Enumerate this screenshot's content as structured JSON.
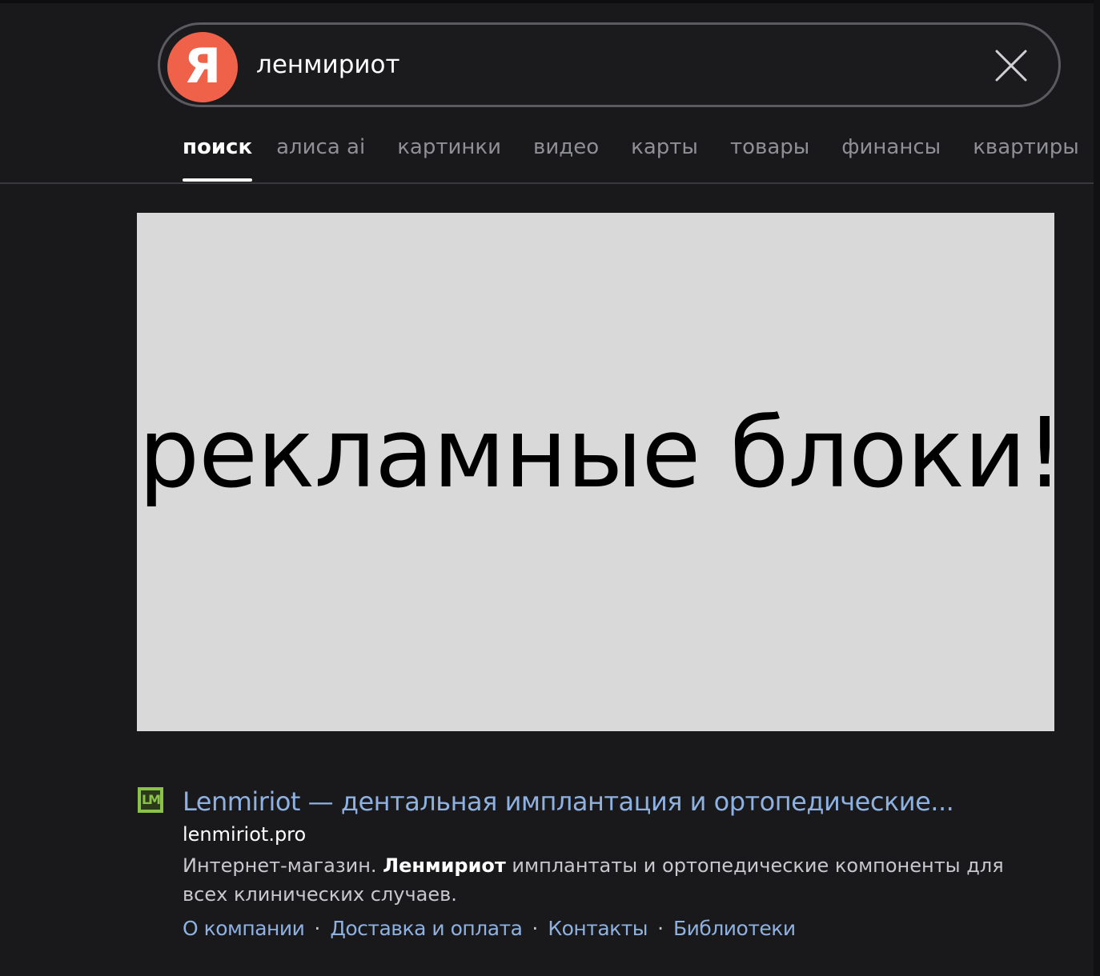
{
  "search": {
    "logo_letter": "Я",
    "query": "ленмириот"
  },
  "tabs": [
    {
      "label": "поиск",
      "active": true
    },
    {
      "label": "алиса ai",
      "active": false
    },
    {
      "label": "картинки",
      "active": false
    },
    {
      "label": "видео",
      "active": false
    },
    {
      "label": "карты",
      "active": false
    },
    {
      "label": "товары",
      "active": false
    },
    {
      "label": "финансы",
      "active": false
    },
    {
      "label": "квартиры",
      "active": false
    }
  ],
  "ad": {
    "text": "рекламные блоки!"
  },
  "result": {
    "favicon_text": "LM",
    "title": "Lenmiriot — дентальная имплантация и ортопедические...",
    "url": "lenmiriot.pro",
    "snippet_before": "Интернет-магазин. ",
    "snippet_bold": "Ленмириот",
    "snippet_after": " имплантаты и ортопедические компоненты для всех клинических случаев.",
    "sitelinks": [
      "О компании",
      "Доставка и оплата",
      "Контакты",
      "Библиотеки"
    ],
    "sitelink_separator": "·"
  },
  "colors": {
    "background": "#19191c",
    "logo": "#f0614a",
    "link": "#8fb1e0",
    "favicon": "#8bc34a",
    "ad_background": "#d9d9d9"
  }
}
